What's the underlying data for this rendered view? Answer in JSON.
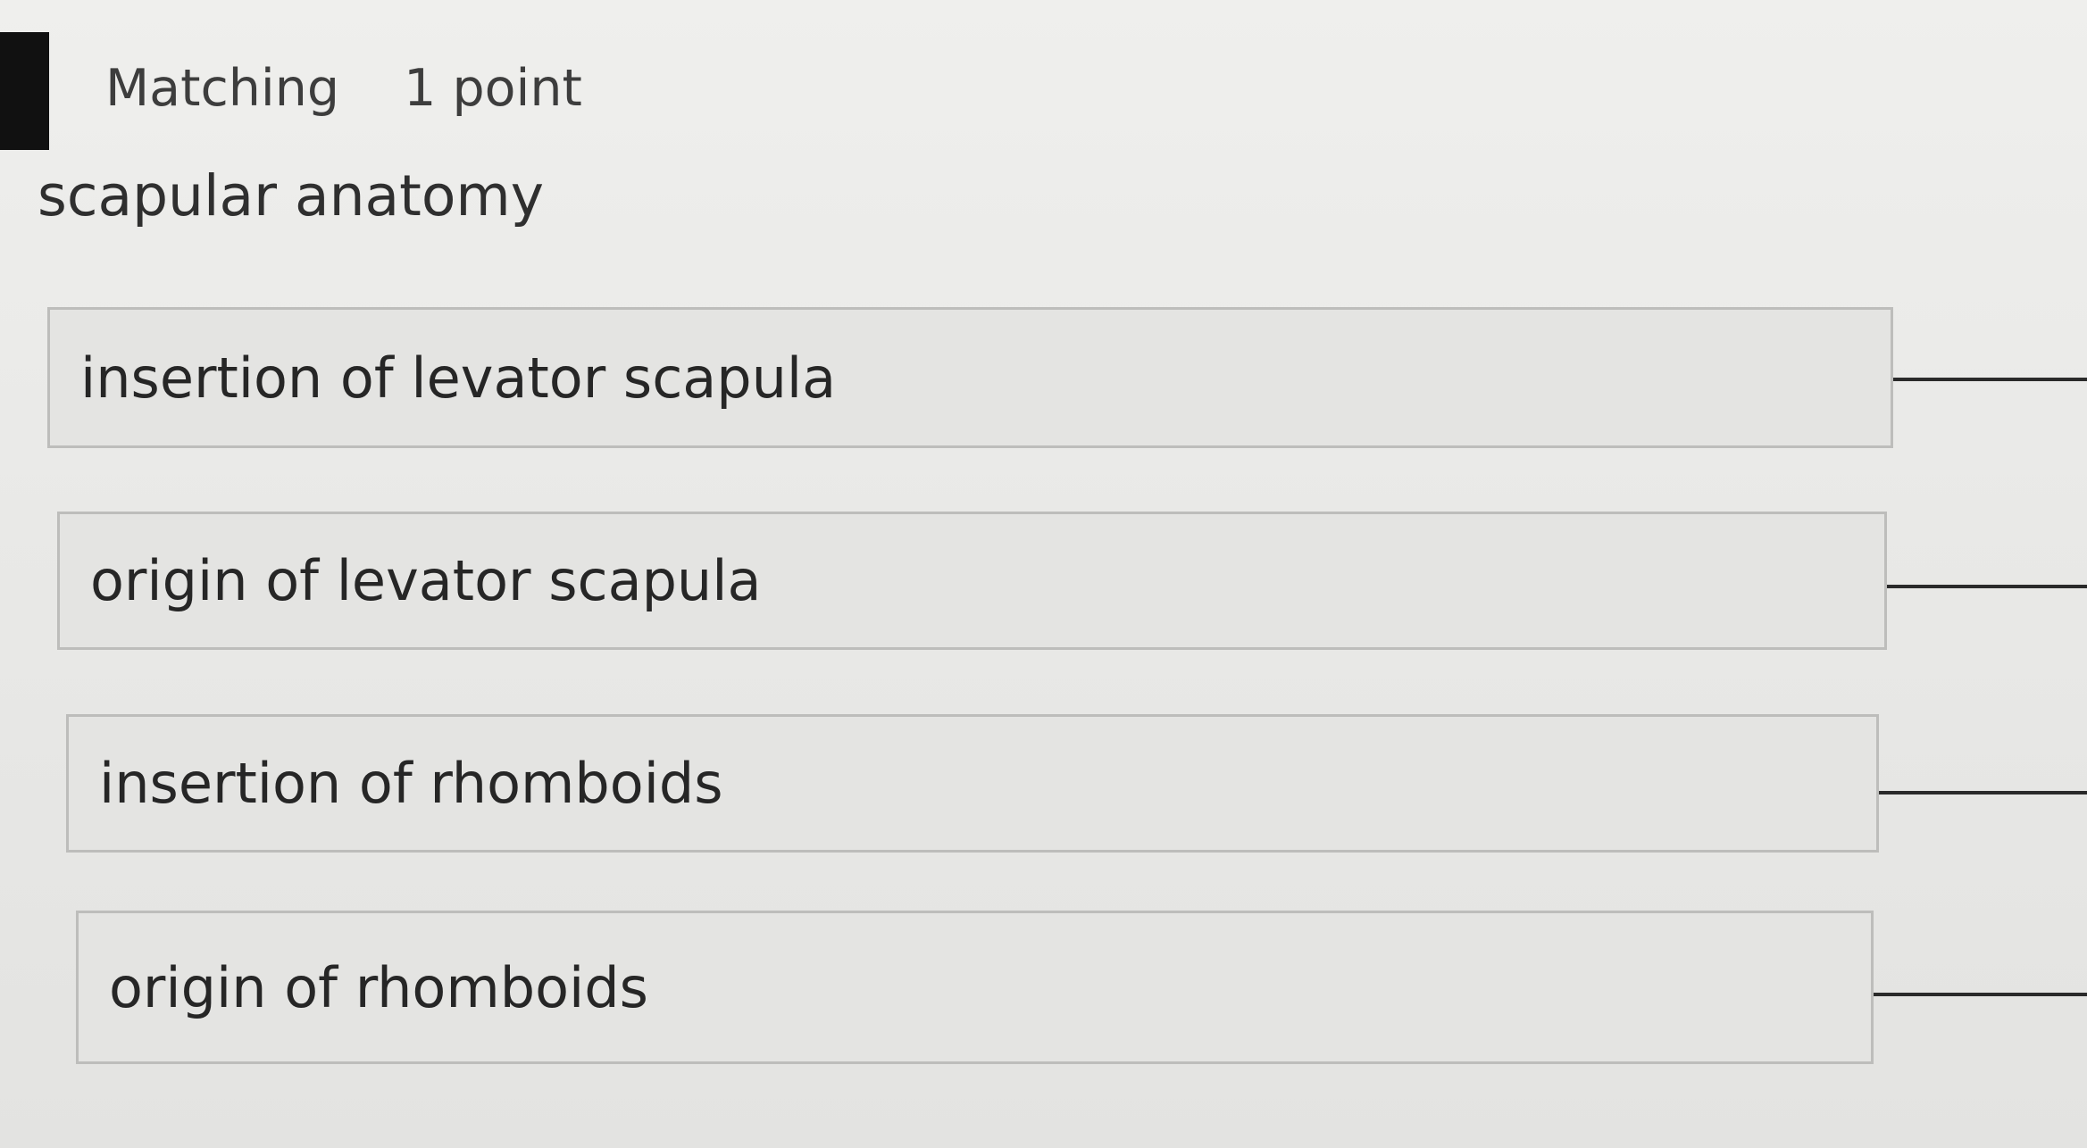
{
  "question": {
    "type_label": "Matching",
    "points_label": "1 point",
    "prompt": "scapular anatomy"
  },
  "match_items": [
    {
      "label": "insertion of levator scapula"
    },
    {
      "label": "origin of levator scapula"
    },
    {
      "label": "insertion of rhomboids"
    },
    {
      "label": "origin of rhomboids"
    }
  ]
}
